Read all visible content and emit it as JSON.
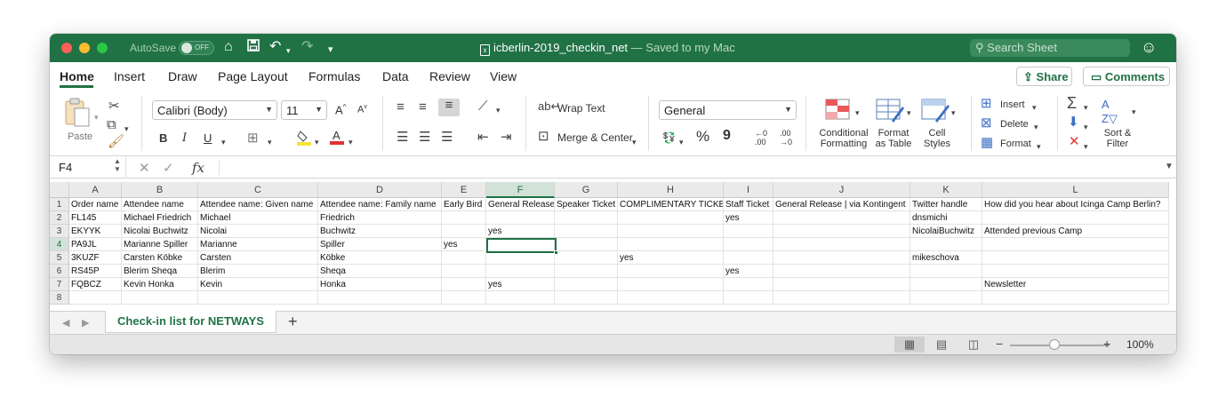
{
  "titlebar": {
    "autosave_label": "AutoSave",
    "autosave_state": "OFF",
    "file_name": "icberlin-2019_checkin_net",
    "saved_status": "— Saved to my Mac",
    "search_placeholder": "Search Sheet",
    "icons": [
      "home-icon",
      "save-icon",
      "undo-icon",
      "redo-icon",
      "customize-icon",
      "account-icon"
    ]
  },
  "ribbon_tabs": [
    "Home",
    "Insert",
    "Draw",
    "Page Layout",
    "Formulas",
    "Data",
    "Review",
    "View"
  ],
  "ribbon_actions": {
    "share": "Share",
    "comments": "Comments"
  },
  "ribbon": {
    "paste": "Paste",
    "font_name": "Calibri (Body)",
    "font_size": "11",
    "bold": "B",
    "italic": "I",
    "underline": "U",
    "wrap_text": "Wrap Text",
    "merge_center": "Merge & Center",
    "number_format": "General",
    "percent": "%",
    "comma": "9",
    "dec_increase": ".00",
    "dec_decrease": ".00",
    "conditional": [
      "Conditional",
      "Formatting"
    ],
    "format_table": [
      "Format",
      "as Table"
    ],
    "cell_styles": [
      "Cell",
      "Styles"
    ],
    "insert": "Insert",
    "delete": "Delete",
    "format": "Format",
    "sort_filter": [
      "Sort &",
      "Filter"
    ]
  },
  "formula_bar": {
    "name_box": "F4",
    "fx": "fx",
    "content": ""
  },
  "sheet": {
    "columns": [
      "A",
      "B",
      "C",
      "D",
      "E",
      "F",
      "G",
      "H",
      "I",
      "J",
      "K",
      "L"
    ],
    "selected_column": "F",
    "selected_row": "4",
    "rows": [
      [
        "1",
        "Order name",
        "Attendee name",
        "Attendee name: Given name",
        "Attendee name: Family name",
        "Early Bird",
        "General Release",
        "Speaker Ticket",
        "COMPLIMENTARY TICKET",
        "Staff Ticket",
        "General Release | via Kontingent",
        "Twitter handle",
        "How did you hear about Icinga Camp Berlin?"
      ],
      [
        "2",
        "FL145",
        "Michael Friedrich",
        "Michael",
        "Friedrich",
        "",
        "",
        "",
        "",
        "yes",
        "",
        "dnsmichi",
        ""
      ],
      [
        "3",
        "EKYYK",
        "Nicolai Buchwitz",
        "Nicolai",
        "Buchwitz",
        "",
        "yes",
        "",
        "",
        "",
        "",
        "NicolaiBuchwitz",
        "Attended previous Camp"
      ],
      [
        "4",
        "PA9JL",
        "Marianne Spiller",
        "Marianne",
        "Spiller",
        "yes",
        "",
        "",
        "",
        "",
        "",
        "",
        ""
      ],
      [
        "5",
        "3KUZF",
        "Carsten Köbke",
        "Carsten",
        "Köbke",
        "",
        "",
        "",
        "yes",
        "",
        "",
        "mikeschova",
        ""
      ],
      [
        "6",
        "RS45P",
        "Blerim Sheqa",
        "Blerim",
        "Sheqa",
        "",
        "",
        "",
        "",
        "yes",
        "",
        "",
        ""
      ],
      [
        "7",
        "FQBCZ",
        "Kevin Honka",
        "Kevin",
        "Honka",
        "",
        "yes",
        "",
        "",
        "",
        "",
        "",
        "Newsletter"
      ],
      [
        "8",
        "",
        "",
        "",
        "",
        "",
        "",
        "",
        "",
        "",
        "",
        "",
        ""
      ]
    ]
  },
  "sheet_tabs": [
    "Check-in list for NETWAYS"
  ],
  "status": {
    "zoom": "100%",
    "zoom_level_percent": 100
  }
}
